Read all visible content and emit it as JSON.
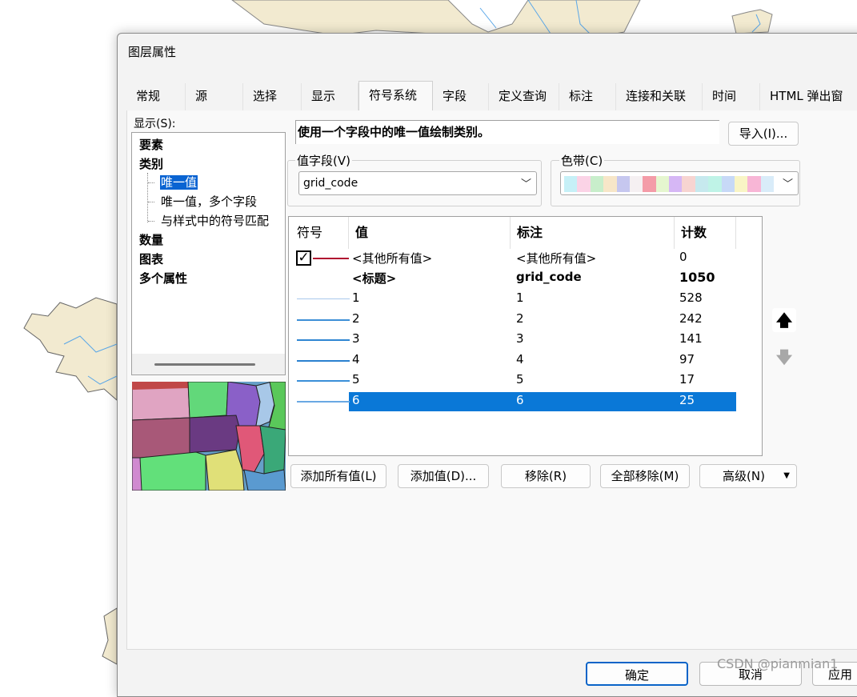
{
  "dialog": {
    "title": "图层属性"
  },
  "tabs": [
    {
      "label": "常规"
    },
    {
      "label": "源"
    },
    {
      "label": "选择"
    },
    {
      "label": "显示"
    },
    {
      "label": "符号系统",
      "active": true
    },
    {
      "label": "字段"
    },
    {
      "label": "定义查询"
    },
    {
      "label": "标注"
    },
    {
      "label": "连接和关联"
    },
    {
      "label": "时间"
    },
    {
      "label": "HTML 弹出窗"
    }
  ],
  "show": {
    "label": "显示(S):",
    "tree": [
      {
        "label": "要素",
        "bold": true
      },
      {
        "label": "类别",
        "bold": true
      },
      {
        "label": "唯一值",
        "selected": true
      },
      {
        "label": "唯一值，多个字段"
      },
      {
        "label": "与样式中的符号匹配"
      },
      {
        "label": "数量",
        "bold": true
      },
      {
        "label": "图表",
        "bold": true
      },
      {
        "label": "多个属性",
        "bold": true
      }
    ]
  },
  "description": "使用一个字段中的唯一值绘制类别。",
  "import_button": "导入(I)...",
  "value_field": {
    "label": "值字段(V)",
    "value": "grid_code"
  },
  "color_ramp": {
    "label": "色带(C)",
    "colors": [
      "#c6f0f7",
      "#fbd3e6",
      "#c8eecb",
      "#f7e6c8",
      "#c6c7ef",
      "#f5f0f2",
      "#f49ca8",
      "#e5f6cf",
      "#d6b7f5",
      "#f7d4d1",
      "#c6e9ee",
      "#bff3e7",
      "#c7d9f7",
      "#f9f5c5",
      "#f8b6d6",
      "#d9ecf9"
    ]
  },
  "table": {
    "headers": {
      "symbol": "符号",
      "value": "值",
      "label": "标注",
      "count": "计数"
    },
    "other_row": {
      "value": "<其他所有值>",
      "label": "<其他所有值>",
      "count": "0",
      "checked": true,
      "color": "#b01030"
    },
    "heading_row": {
      "value": "<标题>",
      "label": "grid_code",
      "count": "1050"
    },
    "rows": [
      {
        "value": "1",
        "label": "1",
        "count": "528",
        "color": "#a9c8ec"
      },
      {
        "value": "2",
        "label": "2",
        "count": "242",
        "color": "#3d8fd6"
      },
      {
        "value": "3",
        "label": "3",
        "count": "141",
        "color": "#2f86d2"
      },
      {
        "value": "4",
        "label": "4",
        "count": "97",
        "color": "#2a80cf"
      },
      {
        "value": "5",
        "label": "5",
        "count": "17",
        "color": "#3a8fd8"
      },
      {
        "value": "6",
        "label": "6",
        "count": "25",
        "color": "#6aa9e3",
        "selected": true
      }
    ]
  },
  "side_buttons": {
    "up": "move-up",
    "down": "move-down"
  },
  "buttons": {
    "add_all": "添加所有值(L)",
    "add": "添加值(D)...",
    "remove": "移除(R)",
    "remove_all": "全部移除(M)",
    "advanced": "高级(N)"
  },
  "footer": {
    "ok": "确定",
    "cancel": "取消",
    "apply": "应用"
  },
  "watermark": "CSDN @pianmian1",
  "accent": "#0a78d7"
}
